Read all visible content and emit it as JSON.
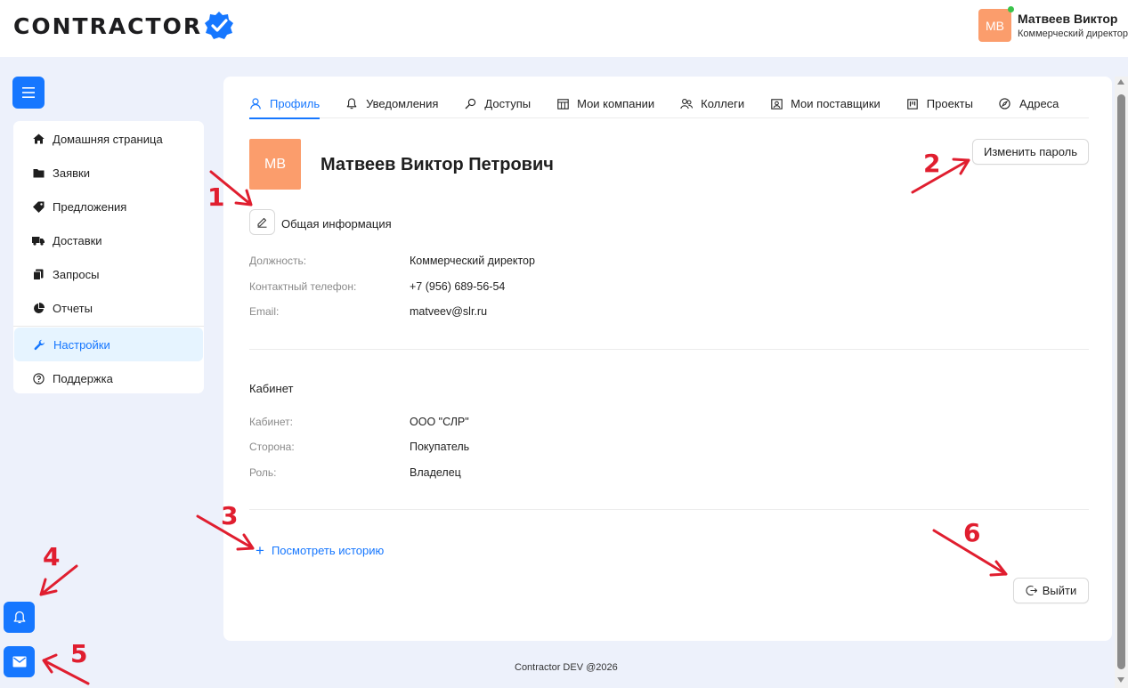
{
  "header": {
    "logo_text": "CONTRACTOR",
    "user": {
      "initials": "MB",
      "name": "Матвеев Виктор",
      "role": "Коммерческий директор"
    }
  },
  "sidebar": {
    "items": [
      {
        "label": "Домашняя страница",
        "icon": "home-icon"
      },
      {
        "label": "Заявки",
        "icon": "folder-icon"
      },
      {
        "label": "Предложения",
        "icon": "tags-icon"
      },
      {
        "label": "Доставки",
        "icon": "truck-icon"
      },
      {
        "label": "Запросы",
        "icon": "copy-icon"
      },
      {
        "label": "Отчеты",
        "icon": "pie-chart-icon"
      },
      {
        "label": "Настройки",
        "icon": "wrench-icon",
        "active": true
      },
      {
        "label": "Поддержка",
        "icon": "question-circle-icon"
      }
    ]
  },
  "tabs": [
    {
      "label": "Профиль",
      "icon": "user-icon",
      "active": true
    },
    {
      "label": "Уведомления",
      "icon": "bell-icon"
    },
    {
      "label": "Доступы",
      "icon": "key-icon"
    },
    {
      "label": "Мои компании",
      "icon": "shop-icon"
    },
    {
      "label": "Коллеги",
      "icon": "team-icon"
    },
    {
      "label": "Мои поставщики",
      "icon": "contacts-icon"
    },
    {
      "label": "Проекты",
      "icon": "project-icon"
    },
    {
      "label": "Адреса",
      "icon": "compass-icon"
    }
  ],
  "profile": {
    "initials": "MB",
    "full_name": "Матвеев Виктор Петрович",
    "change_password_label": "Изменить пароль",
    "general_title": "Общая информация",
    "general_fields": [
      {
        "label": "Должность:",
        "value": "Коммерческий директор"
      },
      {
        "label": "Контактный телефон:",
        "value": "+7 (956) 689-56-54"
      },
      {
        "label": "Email:",
        "value": "matveev@slr.ru"
      }
    ],
    "cabinet_title": "Кабинет",
    "cabinet_fields": [
      {
        "label": "Кабинет:",
        "value": "ООО \"СЛР\""
      },
      {
        "label": "Сторона:",
        "value": "Покупатель"
      },
      {
        "label": "Роль:",
        "value": "Владелец"
      }
    ],
    "history_label": "Посмотреть историю",
    "logout_label": "Выйти"
  },
  "footer": {
    "text": "Contractor DEV @2026"
  },
  "annotations": [
    "1",
    "2",
    "3",
    "4",
    "5",
    "6"
  ],
  "colors": {
    "accent": "#1677ff",
    "avatar": "#fb9d6c",
    "annotation": "#e01e2f",
    "background": "#edf1fb"
  }
}
